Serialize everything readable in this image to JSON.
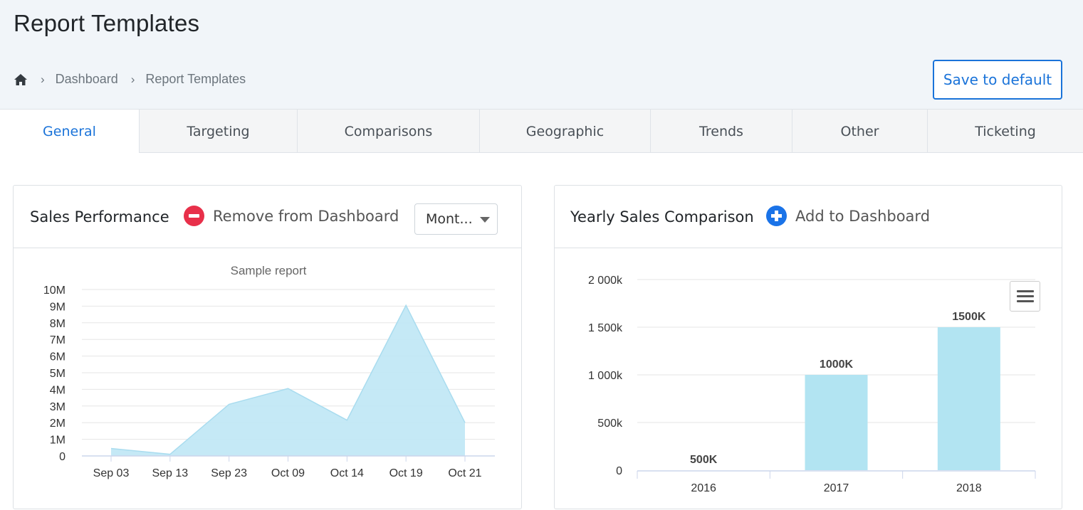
{
  "page": {
    "title": "Report Templates",
    "save_label": "Save to default"
  },
  "breadcrumb": {
    "home_icon": "home-icon",
    "items": [
      "Dashboard",
      "Report Templates"
    ]
  },
  "tabs": [
    {
      "label": "General",
      "active": true
    },
    {
      "label": "Targeting",
      "active": false
    },
    {
      "label": "Comparisons",
      "active": false
    },
    {
      "label": "Geographic",
      "active": false
    },
    {
      "label": "Trends",
      "active": false
    },
    {
      "label": "Other",
      "active": false
    },
    {
      "label": "Ticketing",
      "active": false
    }
  ],
  "cards": {
    "sales": {
      "title": "Sales Performance",
      "action_label": "Remove from Dashboard",
      "action_icon": "minus-circle-icon",
      "period_select": "Mont..."
    },
    "yearly": {
      "title": "Yearly Sales Comparison",
      "action_label": "Add to Dashboard",
      "action_icon": "plus-circle-icon",
      "menu_icon": "hamburger-menu-icon"
    }
  },
  "colors": {
    "accent": "#1a73d9",
    "remove": "#e8304a",
    "add": "#1a73e8",
    "area_fill": "#bfe7f5",
    "bar_fill": "#b2e4f2"
  },
  "chart_data": [
    {
      "type": "area",
      "title": "Sample report",
      "categories": [
        "Sep 03",
        "Sep 13",
        "Sep 23",
        "Oct 09",
        "Oct 14",
        "Oct 19",
        "Oct 21"
      ],
      "values": [
        0.45,
        0.1,
        3.1,
        4.05,
        2.15,
        9.05,
        2.0
      ],
      "unit": "M",
      "ylim": [
        0,
        10
      ],
      "yticks": [
        "0",
        "1M",
        "2M",
        "3M",
        "4M",
        "5M",
        "6M",
        "7M",
        "8M",
        "9M",
        "10M"
      ],
      "grid": true
    },
    {
      "type": "bar",
      "categories": [
        "2016",
        "2017",
        "2018"
      ],
      "values": [
        0,
        1000,
        1500
      ],
      "data_labels": [
        "500K",
        "1000K",
        "1500K"
      ],
      "ylim": [
        0,
        2000
      ],
      "yticks": [
        "0",
        "500k",
        "1 000k",
        "1 500k",
        "2 000k"
      ],
      "grid": true
    }
  ]
}
